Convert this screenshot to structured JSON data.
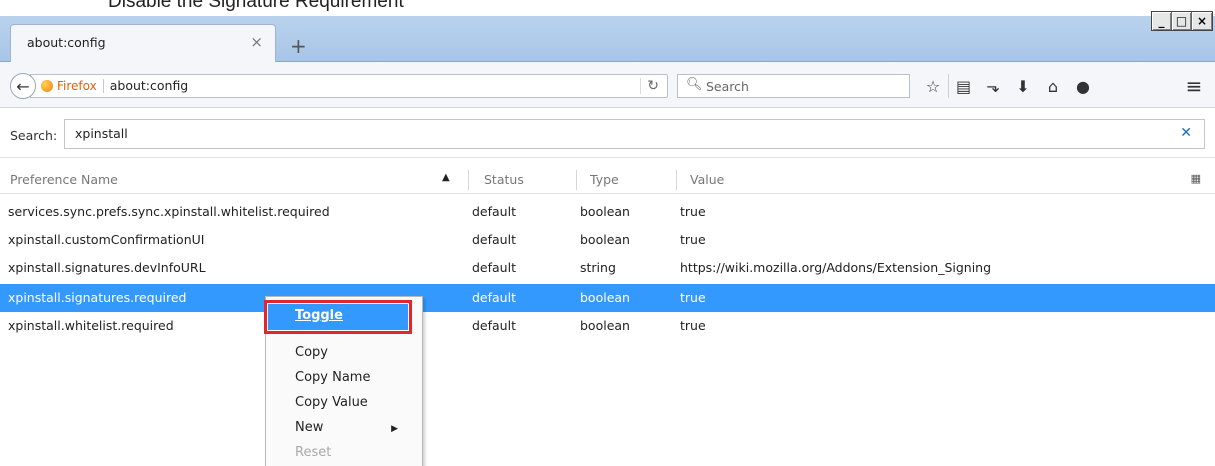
{
  "caption": "Disable the Signature Requirement",
  "window": {
    "tab_title": "about:config",
    "tab_close": "×",
    "new_tab": "+",
    "controls": [
      "_",
      "□",
      "×"
    ]
  },
  "navbar": {
    "back_icon": "arrow-left-icon",
    "identity_label": "Firefox",
    "url": "about:config",
    "reload_icon": "reload-icon",
    "search_placeholder": "Search",
    "toolbar_icons": [
      "star-icon",
      "reading-list-icon",
      "pocket-icon",
      "download-icon",
      "home-icon",
      "chat-icon"
    ],
    "menu_icon": "hamburger-menu-icon"
  },
  "config_search": {
    "label": "Search:",
    "value": "xpinstall",
    "clear_icon": "close-icon"
  },
  "table": {
    "columns": [
      "Preference Name",
      "Status",
      "Type",
      "Value"
    ],
    "sort_direction": "ascending",
    "rows": [
      {
        "name": "services.sync.prefs.sync.xpinstall.whitelist.required",
        "status": "default",
        "type": "boolean",
        "value": "true"
      },
      {
        "name": "xpinstall.customConfirmationUI",
        "status": "default",
        "type": "boolean",
        "value": "true"
      },
      {
        "name": "xpinstall.signatures.devInfoURL",
        "status": "default",
        "type": "string",
        "value": "https://wiki.mozilla.org/Addons/Extension_Signing"
      },
      {
        "name": "xpinstall.signatures.required",
        "status": "default",
        "type": "boolean",
        "value": "true",
        "selected": true
      },
      {
        "name": "xpinstall.whitelist.required",
        "status": "default",
        "type": "boolean",
        "value": "true"
      }
    ]
  },
  "context_menu": {
    "items": [
      "Toggle",
      "Copy",
      "Copy Name",
      "Copy Value",
      "New",
      "Reset"
    ],
    "highlighted": "Toggle",
    "disabled": [
      "Reset"
    ]
  },
  "colors": {
    "selection": "#3399ff",
    "highlight_border": "#e0262e",
    "tab_strip": "#b9d3ee"
  }
}
